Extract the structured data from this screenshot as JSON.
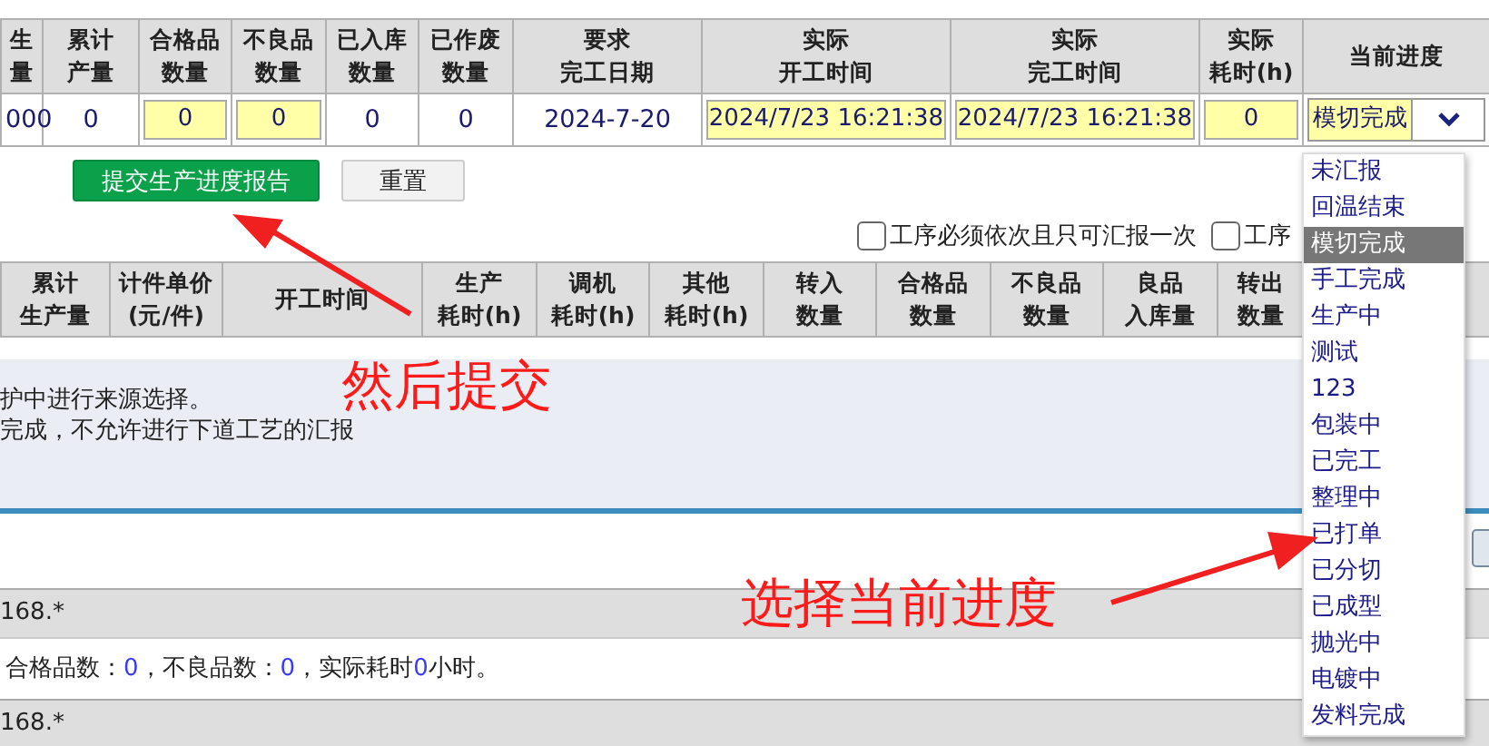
{
  "report_table": {
    "columns": [
      {
        "lines": [
          "生",
          "量"
        ]
      },
      {
        "lines": [
          "累计",
          "产量"
        ]
      },
      {
        "lines": [
          "合格品",
          "数量"
        ]
      },
      {
        "lines": [
          "不良品",
          "数量"
        ]
      },
      {
        "lines": [
          "已入库",
          "数量"
        ]
      },
      {
        "lines": [
          "已作废",
          "数量"
        ]
      },
      {
        "lines": [
          "要求",
          "完工日期"
        ]
      },
      {
        "lines": [
          "实际",
          "开工时间"
        ]
      },
      {
        "lines": [
          "实际",
          "完工时间"
        ]
      },
      {
        "lines": [
          "实际",
          "耗时(h)"
        ]
      },
      {
        "lines": [
          "当前进度"
        ]
      }
    ],
    "row": [
      {
        "kind": "text",
        "value": "000"
      },
      {
        "kind": "text",
        "value": "0"
      },
      {
        "kind": "input",
        "value": "0"
      },
      {
        "kind": "input",
        "value": "0"
      },
      {
        "kind": "text",
        "value": "0"
      },
      {
        "kind": "text",
        "value": "0"
      },
      {
        "kind": "text",
        "value": "2024-7-20"
      },
      {
        "kind": "input",
        "value": "2024/7/23 16:21:38"
      },
      {
        "kind": "input",
        "value": "2024/7/23 16:21:38"
      },
      {
        "kind": "input",
        "value": "0"
      },
      {
        "kind": "select",
        "value": "模切完成"
      }
    ]
  },
  "buttons": [
    {
      "label": "提交生产进度报告",
      "kind": "primary"
    },
    {
      "label": "重置",
      "kind": "default"
    }
  ],
  "options": [
    {
      "label": "工序必须依次且只可汇报一次",
      "checked": false
    },
    {
      "label": "工序",
      "checked": false
    }
  ],
  "detail_table": {
    "columns": [
      {
        "lines": [
          "累计",
          "生产量"
        ]
      },
      {
        "lines": [
          "计件单价",
          "(元/件)"
        ]
      },
      {
        "lines": [
          "开工时间"
        ]
      },
      {
        "lines": [
          "生产",
          "耗时(h)"
        ]
      },
      {
        "lines": [
          "调机",
          "耗时(h)"
        ]
      },
      {
        "lines": [
          "其他",
          "耗时(h)"
        ]
      },
      {
        "lines": [
          "转入",
          "数量"
        ]
      },
      {
        "lines": [
          "合格品",
          "数量"
        ]
      },
      {
        "lines": [
          "不良品",
          "数量"
        ]
      },
      {
        "lines": [
          "良品",
          "入库量"
        ]
      },
      {
        "lines": [
          "转出",
          "数量"
        ]
      }
    ]
  },
  "notice": [
    "护中进行来源选择。",
    "完成，不允许进行下道工艺的汇报"
  ],
  "history": [
    {
      "title": "168.*",
      "summary": [
        {
          "kind": "text",
          "text": "合格品数："
        },
        {
          "kind": "value",
          "text": "0"
        },
        {
          "kind": "text",
          "text": "，不良品数："
        },
        {
          "kind": "value",
          "text": "0"
        },
        {
          "kind": "text",
          "text": "，实际耗时"
        },
        {
          "kind": "value",
          "text": "0"
        },
        {
          "kind": "text",
          "text": "小时。"
        }
      ]
    },
    {
      "title": "168.*"
    }
  ],
  "progress_dropdown": [
    {
      "label": "未汇报",
      "selected": false
    },
    {
      "label": "回温结束",
      "selected": false
    },
    {
      "label": "模切完成",
      "selected": true
    },
    {
      "label": "手工完成",
      "selected": false
    },
    {
      "label": "生产中",
      "selected": false
    },
    {
      "label": "测试",
      "selected": false
    },
    {
      "label": "123",
      "selected": false
    },
    {
      "label": "包装中",
      "selected": false
    },
    {
      "label": "已完工",
      "selected": false
    },
    {
      "label": "整理中",
      "selected": false
    },
    {
      "label": "已打单",
      "selected": false
    },
    {
      "label": "已分切",
      "selected": false
    },
    {
      "label": "已成型",
      "selected": false
    },
    {
      "label": "抛光中",
      "selected": false
    },
    {
      "label": "电镀中",
      "selected": false
    },
    {
      "label": "发料完成",
      "selected": false
    }
  ],
  "annotations": [
    {
      "text": "然后提交",
      "kind": "submit"
    },
    {
      "text": "选择当前进度",
      "kind": "select"
    }
  ]
}
